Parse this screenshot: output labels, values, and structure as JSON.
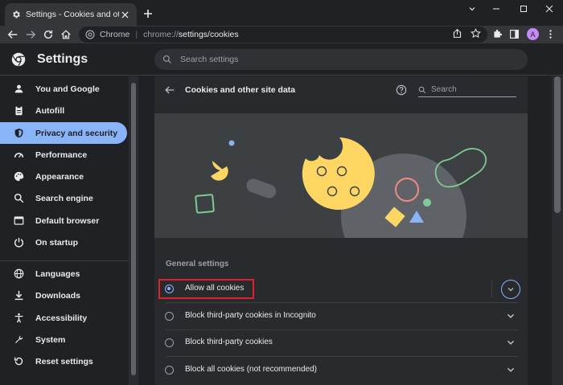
{
  "browser": {
    "tab_title": "Settings - Cookies and other site data",
    "scheme_label": "Chrome",
    "url_host": "chrome://",
    "url_path": "settings/cookies",
    "avatar_letter": "A"
  },
  "header": {
    "title": "Settings",
    "search_placeholder": "Search settings"
  },
  "sidebar": {
    "items": [
      {
        "label": "You and Google",
        "icon": "person-icon"
      },
      {
        "label": "Autofill",
        "icon": "clipboard-icon"
      },
      {
        "label": "Privacy and security",
        "icon": "shield-icon"
      },
      {
        "label": "Performance",
        "icon": "speedometer-icon"
      },
      {
        "label": "Appearance",
        "icon": "palette-icon"
      },
      {
        "label": "Search engine",
        "icon": "search-icon"
      },
      {
        "label": "Default browser",
        "icon": "browser-window-icon"
      },
      {
        "label": "On startup",
        "icon": "power-icon"
      },
      {
        "label": "Languages",
        "icon": "globe-icon"
      },
      {
        "label": "Downloads",
        "icon": "download-icon"
      },
      {
        "label": "Accessibility",
        "icon": "accessibility-icon"
      },
      {
        "label": "System",
        "icon": "wrench-icon"
      },
      {
        "label": "Reset settings",
        "icon": "reset-icon"
      }
    ]
  },
  "page": {
    "title": "Cookies and other site data",
    "search_placeholder": "Search",
    "section_label": "General settings",
    "options": [
      {
        "label": "Allow all cookies",
        "checked": true
      },
      {
        "label": "Block third-party cookies in Incognito",
        "checked": false
      },
      {
        "label": "Block third-party cookies",
        "checked": false
      },
      {
        "label": "Block all cookies (not recommended)",
        "checked": false
      }
    ]
  },
  "colors": {
    "accent": "#8ab4f8",
    "highlight_box": "#e0202f",
    "cookie": "#fdd663"
  }
}
